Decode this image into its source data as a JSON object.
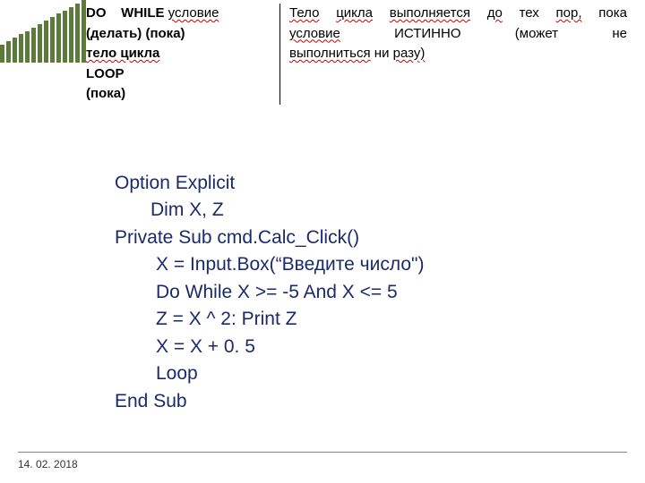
{
  "decor": {
    "bar_count": 14
  },
  "syntax": {
    "line1_do": "DO",
    "line1_while": "WHILE",
    "line1_cond": "условие",
    "line2_a": "(делать)",
    "line2_b": "(пока)",
    "line3": "тело цикла",
    "line4": "LOOP",
    "line5": "(пока)"
  },
  "desc": {
    "l1_a": "Тело",
    "l1_b": "цикла",
    "l1_c": "выполняется",
    "l1_d": "до",
    "l1_e": "тех",
    "l1_f": "пор,",
    "l1_g": "пока",
    "l2_a": "условие",
    "l2_b": "ИСТИННО",
    "l2_c": "(может",
    "l2_d": "не",
    "l3_a": "выполниться",
    "l3_b": "ни",
    "l3_c": "разу)"
  },
  "code": {
    "l1": "Option Explicit",
    "l2": "Dim X, Z",
    "l3": "Private Sub cmd.Calc_Click()",
    "l4": "X = Input.Box(“Введите число\")",
    "l5": "Do While X >= -5 And X <= 5",
    "l6": "Z = X ^ 2: Print Z",
    "l7": "X = X + 0. 5",
    "l8": "Loop",
    "l9": "End Sub"
  },
  "footer": {
    "date": "14. 02. 2018"
  }
}
